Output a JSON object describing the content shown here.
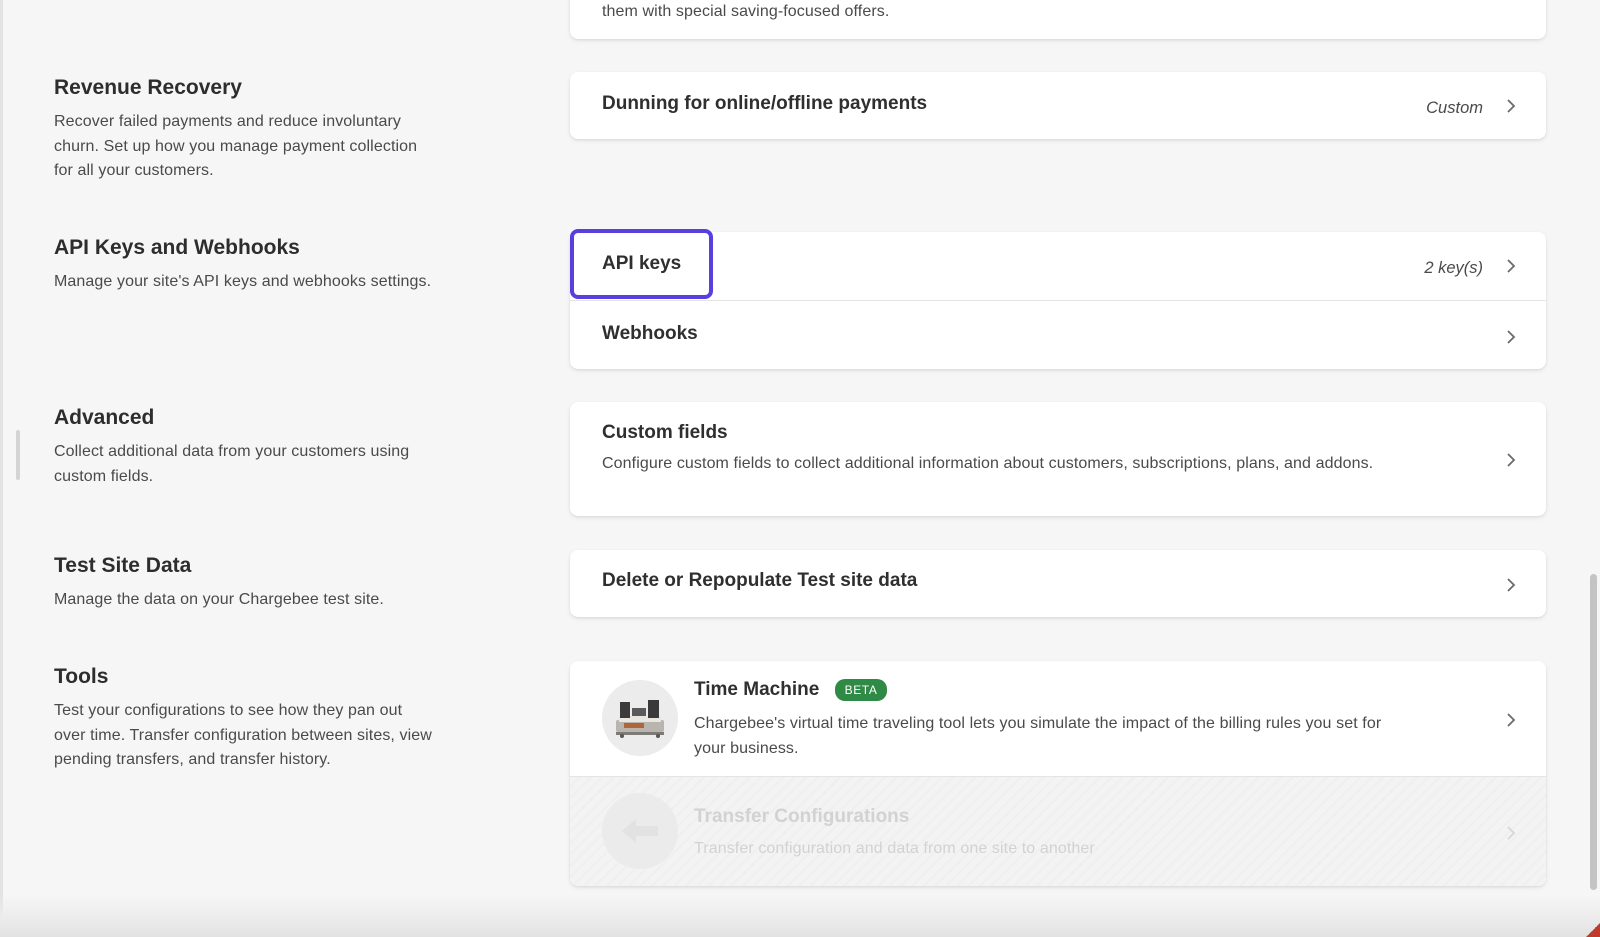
{
  "sections": {
    "previous": {
      "card_desc_tail": "them with special saving-focused offers."
    },
    "revenue_recovery": {
      "title": "Revenue Recovery",
      "description": "Recover failed payments and reduce involuntary churn. Set up how you manage payment collection for all your customers.",
      "rows": [
        {
          "title": "Dunning for online/offline payments",
          "meta": "Custom"
        }
      ]
    },
    "api_keys": {
      "title": "API Keys and Webhooks",
      "description": "Manage your site's API keys and webhooks settings.",
      "rows": [
        {
          "title": "API keys",
          "meta": "2 key(s)"
        },
        {
          "title": "Webhooks"
        }
      ]
    },
    "advanced": {
      "title": "Advanced",
      "description": "Collect additional data from your customers using custom fields.",
      "rows": [
        {
          "title": "Custom fields",
          "description": "Configure custom fields to collect additional information about customers, subscriptions, plans, and addons."
        }
      ]
    },
    "test_site": {
      "title": "Test Site Data",
      "description": "Manage the data on your Chargebee test site.",
      "rows": [
        {
          "title": "Delete or Repopulate Test site data"
        }
      ]
    },
    "tools": {
      "title": "Tools",
      "description": "Test your configurations to see how they pan out over time. Transfer configuration between sites, view pending transfers, and transfer history.",
      "rows": [
        {
          "title": "Time Machine",
          "badge": "BETA",
          "description": "Chargebee's virtual time traveling tool lets you simulate the impact of the billing rules you set for your business.",
          "icon": "time-machine-thumbnail"
        },
        {
          "title": "Transfer Configurations",
          "description": "Transfer configuration and data from one site to another",
          "icon": "transfer-thumbnail",
          "disabled": true
        }
      ]
    }
  },
  "colors": {
    "background": "#f6f6f6",
    "highlight": "#5a3fe0",
    "beta_badge": "#2e8a44"
  }
}
